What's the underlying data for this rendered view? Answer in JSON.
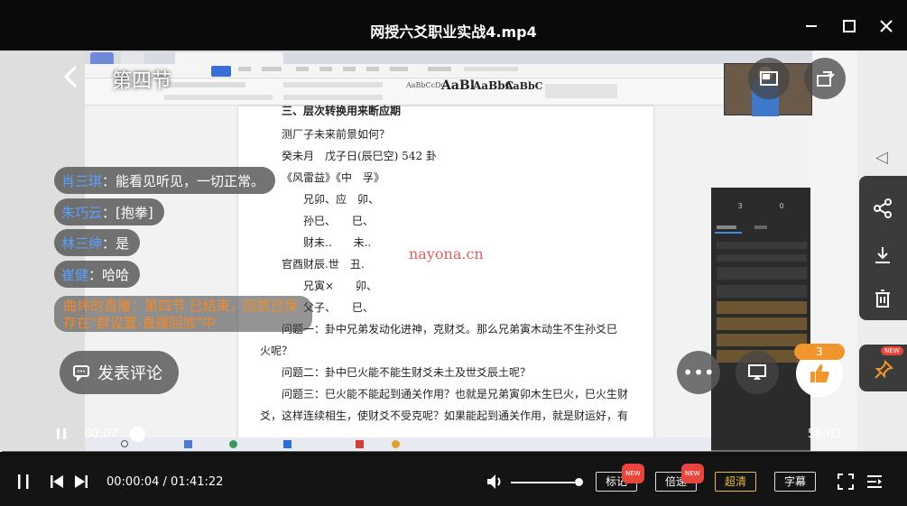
{
  "window": {
    "title": "网授六爻职业实战4.mp4"
  },
  "overlay": {
    "section_title": "第四节",
    "watermark": "nayona.cn",
    "comment_placeholder": "发表评论",
    "like_count": "3"
  },
  "danmu": [
    {
      "name": "肖三琪",
      "text": "：能看见听见，一切正常。"
    },
    {
      "name": "朱巧云",
      "text": "：[抱拳]"
    },
    {
      "name": "林三绅",
      "text": "：是"
    },
    {
      "name": "崔健",
      "text": "：哈哈"
    }
  ],
  "system_msg": "曲炜的直播：第四节 已结束，回放已保存在\"群设置-直播回放\"中",
  "document": {
    "lines": [
      "三、层次转换用来断应期",
      "测厂子未来前景如何？",
      "癸未月　戊子日(辰巳空) 542 卦",
      "《风雷益》《中　孚》",
      "兄卯、应　卯、",
      "孙巳、　　巳、",
      "财未..　　未..",
      "官酉财辰.世　丑.",
      "兄寅×　　卯、",
      "父子、　　巳、",
      "问题一：卦中兄弟发动化进神，克财爻。那么兄弟寅木动生不生孙爻巳",
      "火呢？",
      "问题二：卦中巳火能不能生财爻未土及世爻辰土呢？",
      "问题三：巳火能不能起到通关作用？也就是兄弟寅卯木生巳火，巳火生财",
      "爻，这样连续相生，使财爻不受克呢？如果能起到通关作用，就是财运好，有"
    ]
  },
  "player": {
    "overlay_time_current": "00:07",
    "overlay_time_total": "56:02",
    "current_time": "00:00:04",
    "total_time": "01:41:22",
    "progress": 0.001,
    "volume": 1.0,
    "buttons": {
      "mark": "标记",
      "speed": "倍速",
      "quality": "超清",
      "subtitle": "字幕",
      "new_badge": "NEW"
    }
  },
  "side": {
    "new_badge": "NEW"
  }
}
